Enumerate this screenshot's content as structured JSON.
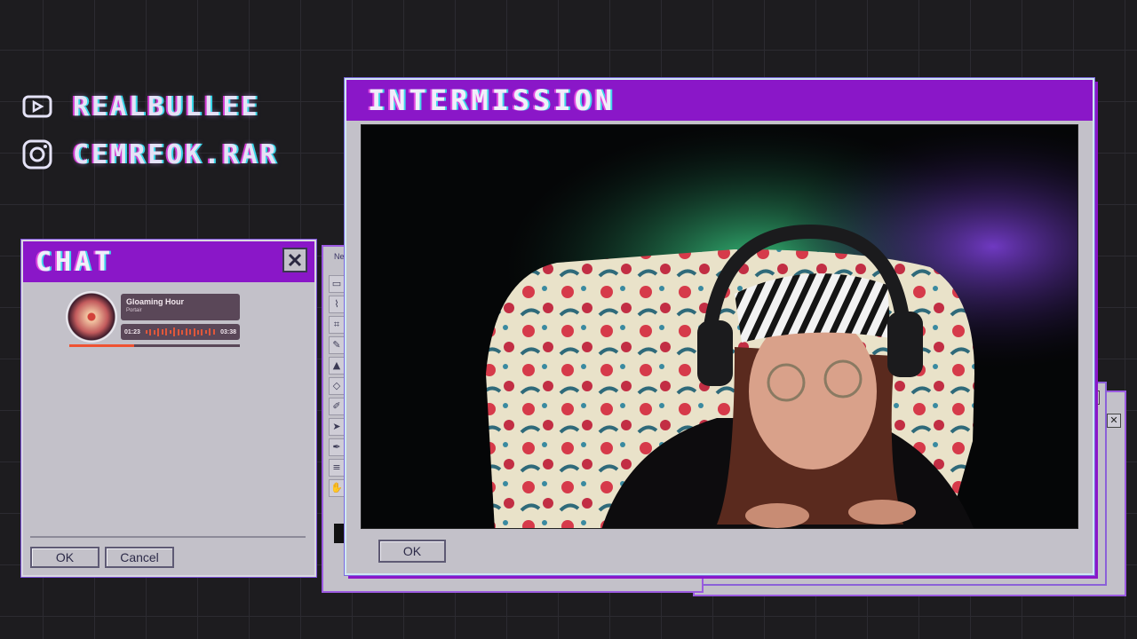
{
  "socials": [
    {
      "icon": "youtube-icon",
      "handle": "REALBULLEE"
    },
    {
      "icon": "instagram-icon",
      "handle": "CEMREOK.RAR"
    }
  ],
  "chat": {
    "title": "CHAT",
    "ok_label": "OK",
    "cancel_label": "Cancel"
  },
  "music": {
    "song": "Gloaming Hour",
    "artist": "Portair",
    "elapsed": "01:23",
    "duration": "03:38",
    "progress": 0.38
  },
  "paint": {
    "title": "Ne"
  },
  "intermission": {
    "title": "INTERMISSION",
    "ok_label": "OK"
  },
  "colors": {
    "accent_purple": "#8a17c8",
    "window_gray": "#c3c1c9",
    "music_orange": "#ef5232"
  }
}
